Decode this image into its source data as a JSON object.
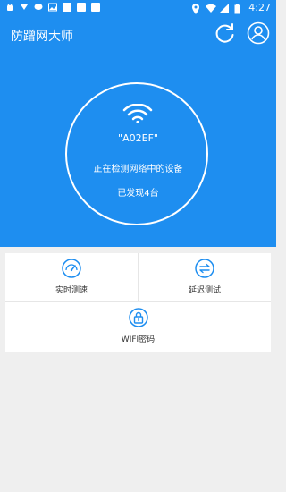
{
  "status_bar": {
    "time": "4:27"
  },
  "header": {
    "title": "防蹭网大师"
  },
  "wifi_card": {
    "ssid": "\"A02EF\"",
    "status_text": "正在检测网络中的设备",
    "found_text": "已发现4台"
  },
  "tools": [
    {
      "label": "实时测速",
      "icon": "speedometer-icon"
    },
    {
      "label": "延迟测试",
      "icon": "latency-icon"
    },
    {
      "label": "WIFI密码",
      "icon": "lock-icon"
    }
  ],
  "colors": {
    "primary": "#1e8ef0",
    "background": "#efefef",
    "text": "#333333"
  }
}
